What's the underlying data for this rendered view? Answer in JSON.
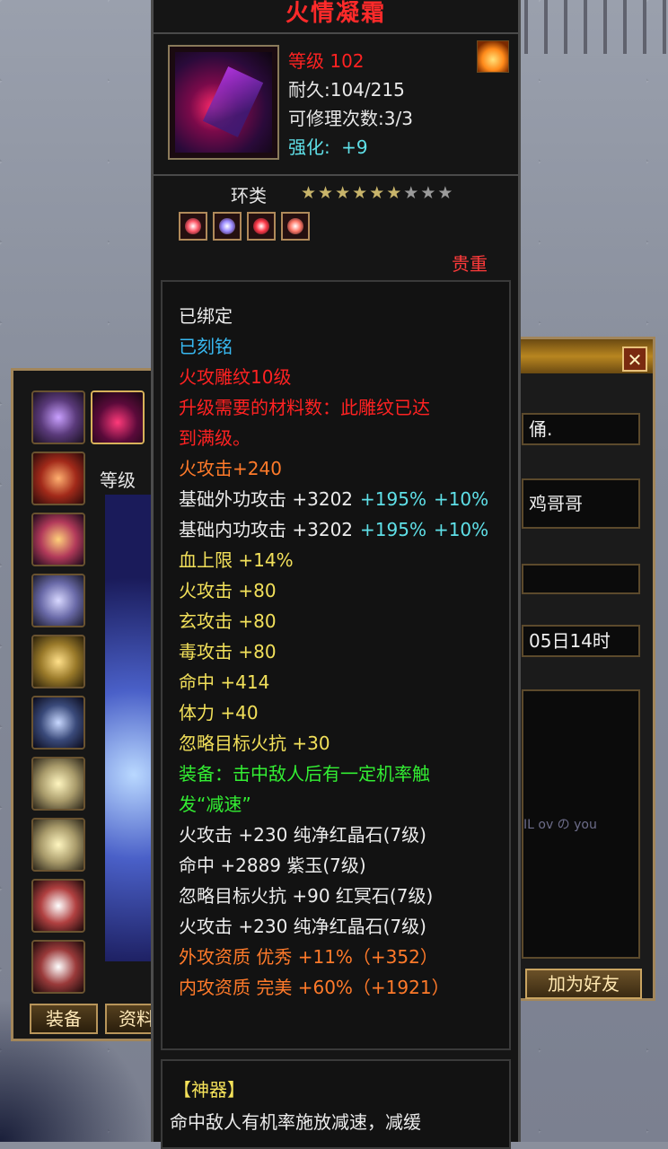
{
  "item": {
    "name": "火情凝霜",
    "level_text": "等级 102",
    "durability": "耐久:104/215",
    "repairs": "可修理次数:3/3",
    "enhance_label": "强化:",
    "enhance_value": "+9",
    "category": "环类",
    "stars_filled": 6,
    "stars_total": 9,
    "rarity": "贵重",
    "gem_colors": [
      "#ff5a6a",
      "#9a8aff",
      "#ff3a4a",
      "#ff7a6a"
    ]
  },
  "attributes": [
    {
      "text": "已绑定",
      "color": "white"
    },
    {
      "text": "已刻铭",
      "color": "cyan"
    },
    {
      "text": "火攻雕纹10级",
      "color": "red"
    },
    {
      "text": "升级需要的材料数：此雕纹已达",
      "color": "red"
    },
    {
      "text": "到满级。",
      "color": "red"
    },
    {
      "text": "火攻击+240",
      "color": "orange"
    },
    {
      "text": "基础外功攻击 +3202",
      "color": "white",
      "extra1": "+195%",
      "extra2": "+10%"
    },
    {
      "text": "基础内功攻击 +3202",
      "color": "white",
      "extra1": "+195%",
      "extra2": "+10%"
    },
    {
      "text": "血上限 +14%",
      "color": "yellow"
    },
    {
      "text": "火攻击 +80",
      "color": "yellow"
    },
    {
      "text": "玄攻击 +80",
      "color": "yellow"
    },
    {
      "text": "毒攻击 +80",
      "color": "yellow"
    },
    {
      "text": "命中 +414",
      "color": "yellow"
    },
    {
      "text": "体力 +40",
      "color": "yellow"
    },
    {
      "text": "忽略目标火抗 +30",
      "color": "yellow"
    },
    {
      "text": "装备：击中敌人后有一定机率触",
      "color": "green"
    },
    {
      "text": "发“减速”",
      "color": "green"
    },
    {
      "text": "火攻击 +230 纯净红晶石(7级)",
      "color": "white"
    },
    {
      "text": "命中 +2889 紫玉(7级)",
      "color": "white"
    },
    {
      "text": "忽略目标火抗 +90 红冥石(7级)",
      "color": "white"
    },
    {
      "text": "火攻击 +230 纯净红晶石(7级)",
      "color": "white"
    },
    {
      "text": "外攻资质  优秀 +11%（+352）",
      "color": "orange"
    },
    {
      "text": "内攻资质  完美 +60%（+1921）",
      "color": "orange"
    }
  ],
  "artifact": {
    "title": "【神器】",
    "desc": "命中敌人有机率施放减速，减缓"
  },
  "equip_window": {
    "level_label": "等级",
    "tab_equip": "装备",
    "tab_info": "资料"
  },
  "right_window": {
    "field1": "俑.",
    "field2": "鸡哥哥",
    "field3": "",
    "field4": "05日14时",
    "faint_text": "IL ov の you",
    "add_friend": "加为好友",
    "close_glyph": "✕"
  }
}
